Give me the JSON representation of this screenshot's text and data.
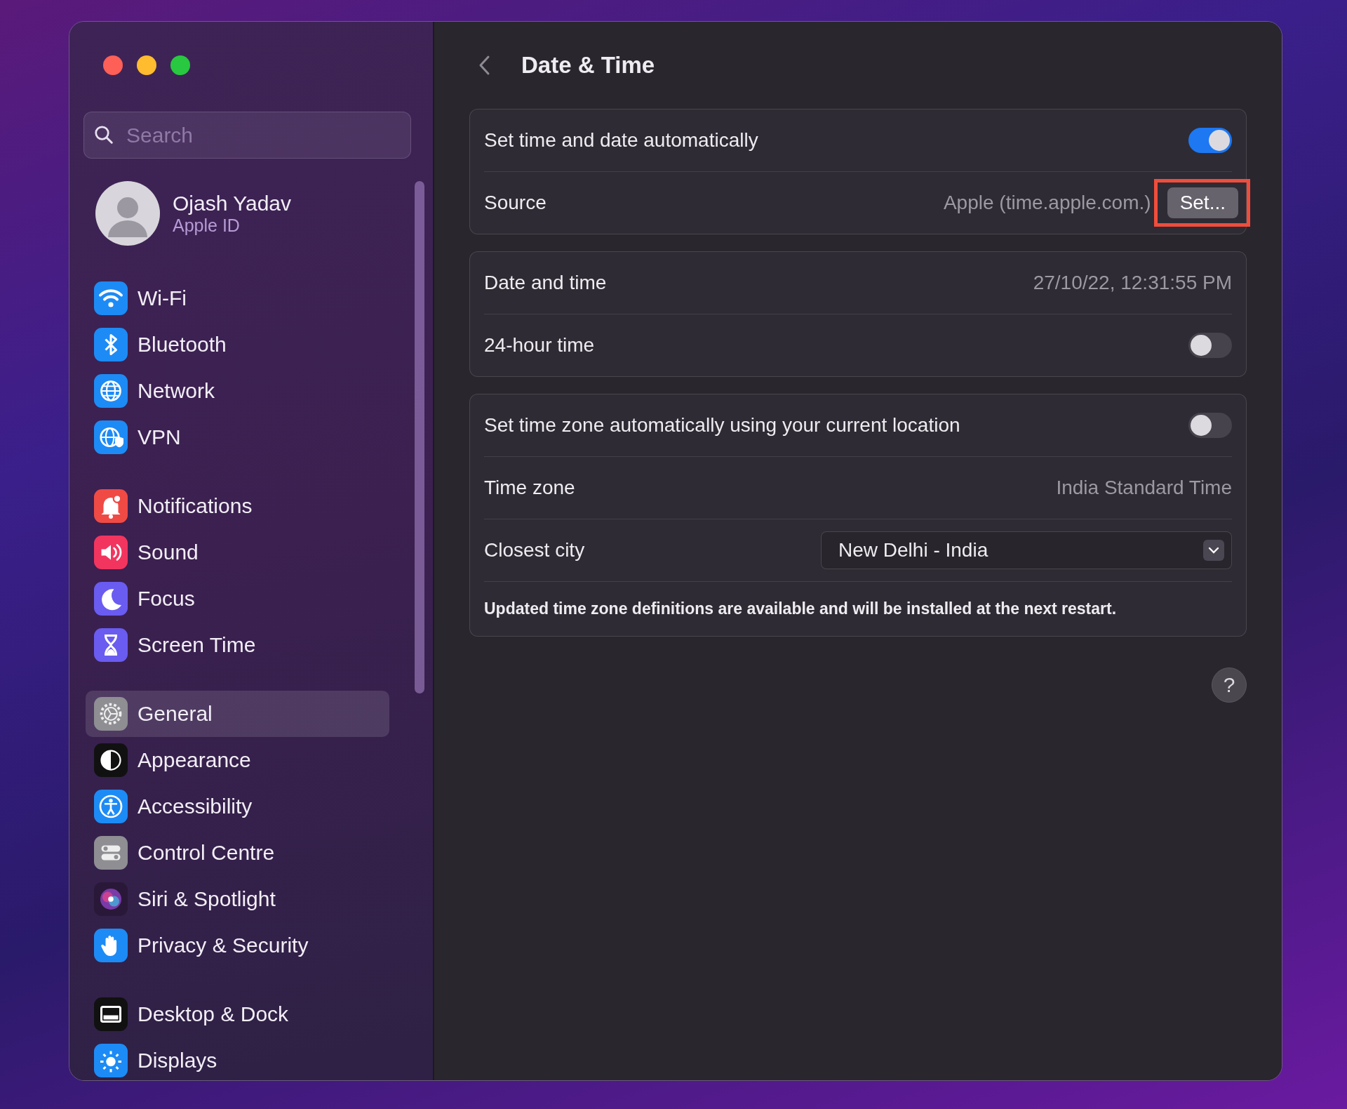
{
  "window": {
    "title": "Date & Time"
  },
  "sidebar": {
    "search": {
      "placeholder": "Search"
    },
    "profile": {
      "name": "Ojash Yadav",
      "subtitle": "Apple ID"
    },
    "groups": [
      {
        "items": [
          {
            "label": "Wi-Fi",
            "selected": false
          },
          {
            "label": "Bluetooth",
            "selected": false
          },
          {
            "label": "Network",
            "selected": false
          },
          {
            "label": "VPN",
            "selected": false
          }
        ]
      },
      {
        "items": [
          {
            "label": "Notifications",
            "selected": false
          },
          {
            "label": "Sound",
            "selected": false
          },
          {
            "label": "Focus",
            "selected": false
          },
          {
            "label": "Screen Time",
            "selected": false
          }
        ]
      },
      {
        "items": [
          {
            "label": "General",
            "selected": true
          },
          {
            "label": "Appearance",
            "selected": false
          },
          {
            "label": "Accessibility",
            "selected": false
          },
          {
            "label": "Control Centre",
            "selected": false
          },
          {
            "label": "Siri & Spotlight",
            "selected": false
          },
          {
            "label": "Privacy & Security",
            "selected": false
          }
        ]
      },
      {
        "items": [
          {
            "label": "Desktop & Dock",
            "selected": false
          },
          {
            "label": "Displays",
            "selected": false
          }
        ]
      }
    ]
  },
  "cards": [
    {
      "rows": [
        {
          "kind": "toggle",
          "label": "Set time and date automatically",
          "on": true
        },
        {
          "kind": "value_button",
          "label": "Source",
          "value": "Apple (time.apple.com.)",
          "button": "Set...",
          "highlighted": true
        }
      ]
    },
    {
      "rows": [
        {
          "kind": "value",
          "label": "Date and time",
          "value": "27/10/22, 12:31:55 PM"
        },
        {
          "kind": "toggle",
          "label": "24-hour time",
          "on": false
        }
      ]
    },
    {
      "rows": [
        {
          "kind": "toggle",
          "label": "Set time zone automatically using your current location",
          "on": false
        },
        {
          "kind": "value",
          "label": "Time zone",
          "value": "India Standard Time"
        },
        {
          "kind": "select",
          "label": "Closest city",
          "value": "New Delhi - India"
        },
        {
          "kind": "note",
          "label": "Updated time zone definitions are available and will be installed at the next restart."
        }
      ]
    }
  ],
  "help": {
    "label": "?"
  }
}
